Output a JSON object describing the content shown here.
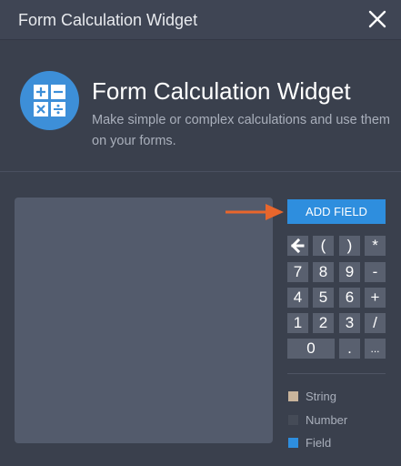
{
  "window": {
    "title": "Form Calculation Widget"
  },
  "header": {
    "title": "Form Calculation Widget",
    "description": "Make simple or complex calculations and use them on your forms."
  },
  "toolbar": {
    "add_field_label": "ADD FIELD"
  },
  "keypad": {
    "rows": [
      [
        "←",
        "(",
        ")",
        "*"
      ],
      [
        "7",
        "8",
        "9",
        "-"
      ],
      [
        "4",
        "5",
        "6",
        "+"
      ],
      [
        "1",
        "2",
        "3",
        "/"
      ],
      [
        "0",
        ".",
        "..."
      ]
    ]
  },
  "legend": [
    {
      "label": "String",
      "color": "#c8b49c"
    },
    {
      "label": "Number",
      "color": "#454b57"
    },
    {
      "label": "Field",
      "color": "#2e8ede"
    }
  ],
  "colors": {
    "accent": "#2e8ede",
    "arrow": "#e8662c",
    "background": "#3a404d"
  },
  "icons": {
    "close": "close-icon",
    "app": "calculator-icon",
    "backspace": "backspace-arrow-icon"
  }
}
